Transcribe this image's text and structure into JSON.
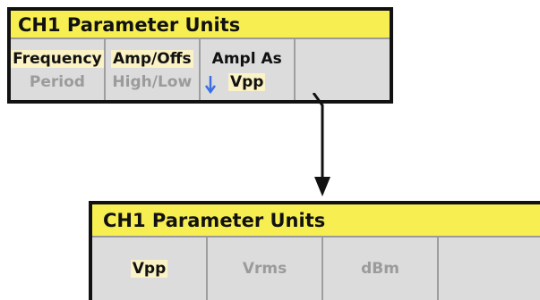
{
  "top_panel": {
    "title": "CH1 Parameter Units",
    "softkeys": [
      {
        "top": "Frequency",
        "bottom": "Period"
      },
      {
        "top": "Amp/Offs",
        "bottom": "High/Low"
      },
      {
        "top": "Ampl As",
        "bottom": "Vpp"
      }
    ]
  },
  "bottom_panel": {
    "title": "CH1 Parameter Units",
    "softkeys": [
      "Vpp",
      "Vrms",
      "dBm"
    ]
  },
  "icons": {
    "scroll": "down-arrow-icon",
    "connector": "connector-arrow-icon"
  },
  "colors": {
    "title_bar": "#f7ef52",
    "highlight": "#fbf3c6",
    "softkey_bg": "#dcdcdc",
    "dim_text": "#9b9b9b",
    "arrow_blue": "#3b6ee6"
  }
}
